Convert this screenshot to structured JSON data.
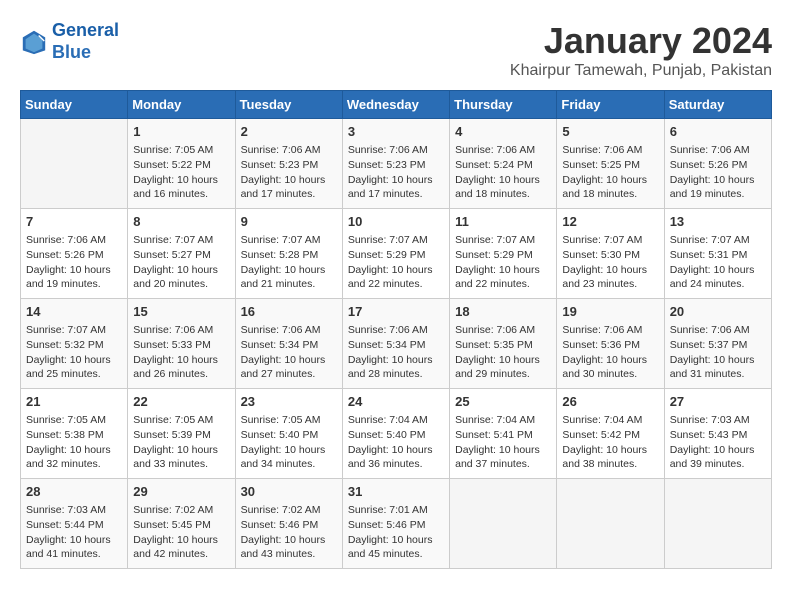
{
  "header": {
    "logo_line1": "General",
    "logo_line2": "Blue",
    "title": "January 2024",
    "subtitle": "Khairpur Tamewah, Punjab, Pakistan"
  },
  "calendar": {
    "days_of_week": [
      "Sunday",
      "Monday",
      "Tuesday",
      "Wednesday",
      "Thursday",
      "Friday",
      "Saturday"
    ],
    "weeks": [
      [
        {
          "day": "",
          "content": ""
        },
        {
          "day": "1",
          "content": "Sunrise: 7:05 AM\nSunset: 5:22 PM\nDaylight: 10 hours\nand 16 minutes."
        },
        {
          "day": "2",
          "content": "Sunrise: 7:06 AM\nSunset: 5:23 PM\nDaylight: 10 hours\nand 17 minutes."
        },
        {
          "day": "3",
          "content": "Sunrise: 7:06 AM\nSunset: 5:23 PM\nDaylight: 10 hours\nand 17 minutes."
        },
        {
          "day": "4",
          "content": "Sunrise: 7:06 AM\nSunset: 5:24 PM\nDaylight: 10 hours\nand 18 minutes."
        },
        {
          "day": "5",
          "content": "Sunrise: 7:06 AM\nSunset: 5:25 PM\nDaylight: 10 hours\nand 18 minutes."
        },
        {
          "day": "6",
          "content": "Sunrise: 7:06 AM\nSunset: 5:26 PM\nDaylight: 10 hours\nand 19 minutes."
        }
      ],
      [
        {
          "day": "7",
          "content": "Sunrise: 7:06 AM\nSunset: 5:26 PM\nDaylight: 10 hours\nand 19 minutes."
        },
        {
          "day": "8",
          "content": "Sunrise: 7:07 AM\nSunset: 5:27 PM\nDaylight: 10 hours\nand 20 minutes."
        },
        {
          "day": "9",
          "content": "Sunrise: 7:07 AM\nSunset: 5:28 PM\nDaylight: 10 hours\nand 21 minutes."
        },
        {
          "day": "10",
          "content": "Sunrise: 7:07 AM\nSunset: 5:29 PM\nDaylight: 10 hours\nand 22 minutes."
        },
        {
          "day": "11",
          "content": "Sunrise: 7:07 AM\nSunset: 5:29 PM\nDaylight: 10 hours\nand 22 minutes."
        },
        {
          "day": "12",
          "content": "Sunrise: 7:07 AM\nSunset: 5:30 PM\nDaylight: 10 hours\nand 23 minutes."
        },
        {
          "day": "13",
          "content": "Sunrise: 7:07 AM\nSunset: 5:31 PM\nDaylight: 10 hours\nand 24 minutes."
        }
      ],
      [
        {
          "day": "14",
          "content": "Sunrise: 7:07 AM\nSunset: 5:32 PM\nDaylight: 10 hours\nand 25 minutes."
        },
        {
          "day": "15",
          "content": "Sunrise: 7:06 AM\nSunset: 5:33 PM\nDaylight: 10 hours\nand 26 minutes."
        },
        {
          "day": "16",
          "content": "Sunrise: 7:06 AM\nSunset: 5:34 PM\nDaylight: 10 hours\nand 27 minutes."
        },
        {
          "day": "17",
          "content": "Sunrise: 7:06 AM\nSunset: 5:34 PM\nDaylight: 10 hours\nand 28 minutes."
        },
        {
          "day": "18",
          "content": "Sunrise: 7:06 AM\nSunset: 5:35 PM\nDaylight: 10 hours\nand 29 minutes."
        },
        {
          "day": "19",
          "content": "Sunrise: 7:06 AM\nSunset: 5:36 PM\nDaylight: 10 hours\nand 30 minutes."
        },
        {
          "day": "20",
          "content": "Sunrise: 7:06 AM\nSunset: 5:37 PM\nDaylight: 10 hours\nand 31 minutes."
        }
      ],
      [
        {
          "day": "21",
          "content": "Sunrise: 7:05 AM\nSunset: 5:38 PM\nDaylight: 10 hours\nand 32 minutes."
        },
        {
          "day": "22",
          "content": "Sunrise: 7:05 AM\nSunset: 5:39 PM\nDaylight: 10 hours\nand 33 minutes."
        },
        {
          "day": "23",
          "content": "Sunrise: 7:05 AM\nSunset: 5:40 PM\nDaylight: 10 hours\nand 34 minutes."
        },
        {
          "day": "24",
          "content": "Sunrise: 7:04 AM\nSunset: 5:40 PM\nDaylight: 10 hours\nand 36 minutes."
        },
        {
          "day": "25",
          "content": "Sunrise: 7:04 AM\nSunset: 5:41 PM\nDaylight: 10 hours\nand 37 minutes."
        },
        {
          "day": "26",
          "content": "Sunrise: 7:04 AM\nSunset: 5:42 PM\nDaylight: 10 hours\nand 38 minutes."
        },
        {
          "day": "27",
          "content": "Sunrise: 7:03 AM\nSunset: 5:43 PM\nDaylight: 10 hours\nand 39 minutes."
        }
      ],
      [
        {
          "day": "28",
          "content": "Sunrise: 7:03 AM\nSunset: 5:44 PM\nDaylight: 10 hours\nand 41 minutes."
        },
        {
          "day": "29",
          "content": "Sunrise: 7:02 AM\nSunset: 5:45 PM\nDaylight: 10 hours\nand 42 minutes."
        },
        {
          "day": "30",
          "content": "Sunrise: 7:02 AM\nSunset: 5:46 PM\nDaylight: 10 hours\nand 43 minutes."
        },
        {
          "day": "31",
          "content": "Sunrise: 7:01 AM\nSunset: 5:46 PM\nDaylight: 10 hours\nand 45 minutes."
        },
        {
          "day": "",
          "content": ""
        },
        {
          "day": "",
          "content": ""
        },
        {
          "day": "",
          "content": ""
        }
      ]
    ]
  }
}
